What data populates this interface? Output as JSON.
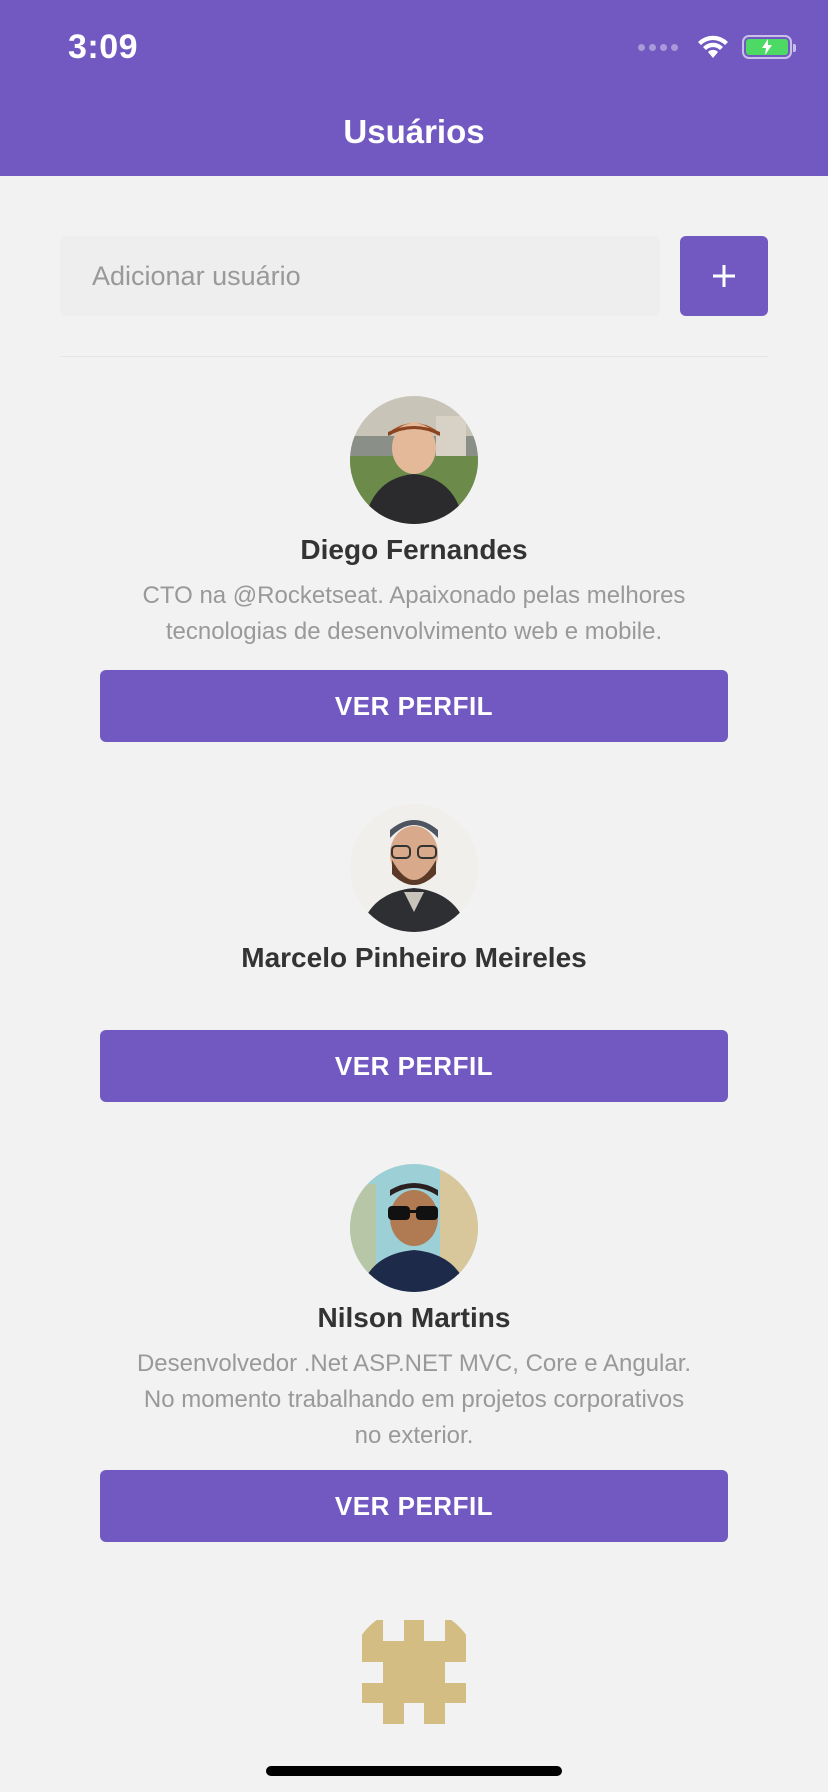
{
  "status_bar": {
    "time": "3:09"
  },
  "header": {
    "title": "Usuários"
  },
  "form": {
    "placeholder": "Adicionar usuário",
    "add_icon": "plus-icon"
  },
  "users": [
    {
      "name": "Diego Fernandes",
      "bio_lines": [
        "CTO na @Rocketseat. Apaixonado pelas melhores",
        "tecnologias de desenvolvimento web e mobile."
      ],
      "button": "VER PERFIL"
    },
    {
      "name": "Marcelo Pinheiro Meireles",
      "bio_lines": [],
      "button": "VER PERFIL"
    },
    {
      "name": "Nilson Martins",
      "bio_lines": [
        "Desenvolvedor .Net ASP.NET MVC, Core e Angular.",
        "No momento trabalhando em projetos corporativos",
        "no exterior."
      ],
      "button": "VER PERFIL"
    }
  ],
  "colors": {
    "primary": "#7159c1",
    "background": "#f2f2f2",
    "identicon": "#d3bd82"
  }
}
